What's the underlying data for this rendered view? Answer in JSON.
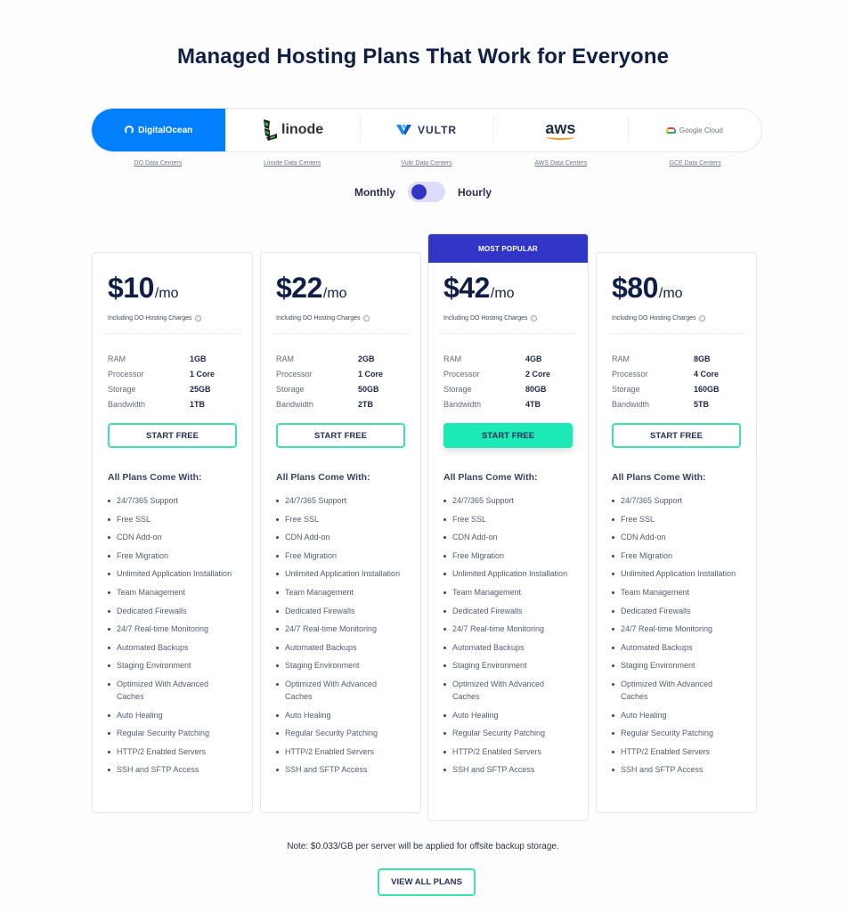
{
  "title": "Managed Hosting Plans That Work for Everyone",
  "providers": [
    {
      "name": "DigitalOcean",
      "link": "DO Data Centers",
      "active": true
    },
    {
      "name": "linode",
      "link": "Linode Data Centers",
      "active": false
    },
    {
      "name": "VULTR",
      "link": "Vultr Data Centers",
      "active": false
    },
    {
      "name": "aws",
      "link": "AWS Data Centers",
      "active": false
    },
    {
      "name": "Google Cloud",
      "link": "GCE Data Centers",
      "active": false
    }
  ],
  "billing": {
    "left": "Monthly",
    "right": "Hourly",
    "selected": "Monthly"
  },
  "colors": {
    "accent_blue": "#0080ff",
    "popular": "#3236c6",
    "cta_green": "#1de9b6"
  },
  "plans": [
    {
      "price": "$10",
      "per": "/mo",
      "incl": "Including DO Hosting Charges",
      "popular": false,
      "specs": [
        {
          "k": "RAM",
          "v": "1GB"
        },
        {
          "k": "Processor",
          "v": "1 Core"
        },
        {
          "k": "Storage",
          "v": "25GB"
        },
        {
          "k": "Bandwidth",
          "v": "1TB"
        }
      ],
      "cta": "START FREE"
    },
    {
      "price": "$22",
      "per": "/mo",
      "incl": "Including DO Hosting Charges",
      "popular": false,
      "specs": [
        {
          "k": "RAM",
          "v": "2GB"
        },
        {
          "k": "Processor",
          "v": "1 Core"
        },
        {
          "k": "Storage",
          "v": "50GB"
        },
        {
          "k": "Bandwidth",
          "v": "2TB"
        }
      ],
      "cta": "START FREE"
    },
    {
      "price": "$42",
      "per": "/mo",
      "incl": "Including DO Hosting Charges",
      "popular": true,
      "badge": "MOST POPULAR",
      "specs": [
        {
          "k": "RAM",
          "v": "4GB"
        },
        {
          "k": "Processor",
          "v": "2 Core"
        },
        {
          "k": "Storage",
          "v": "80GB"
        },
        {
          "k": "Bandwidth",
          "v": "4TB"
        }
      ],
      "cta": "START FREE"
    },
    {
      "price": "$80",
      "per": "/mo",
      "incl": "Including DO Hosting Charges",
      "popular": false,
      "specs": [
        {
          "k": "RAM",
          "v": "8GB"
        },
        {
          "k": "Processor",
          "v": "4 Core"
        },
        {
          "k": "Storage",
          "v": "160GB"
        },
        {
          "k": "Bandwidth",
          "v": "5TB"
        }
      ],
      "cta": "START FREE"
    }
  ],
  "features_title": "All Plans Come With:",
  "features": [
    "24/7/365 Support",
    "Free SSL",
    "CDN Add-on",
    "Free Migration",
    "Unlimited Application Installation",
    "Team Management",
    "Dedicated Firewalls",
    "24/7 Real-time Monitoring",
    "Automated Backups",
    "Staging Environment",
    "Optimized With Advanced Caches",
    "Auto Healing",
    "Regular Security Patching",
    "HTTP/2 Enabled Servers",
    "SSH and SFTP Access"
  ],
  "note": "Note: $0.033/GB per server will be applied for offsite backup storage.",
  "view_all": "VIEW ALL PLANS"
}
